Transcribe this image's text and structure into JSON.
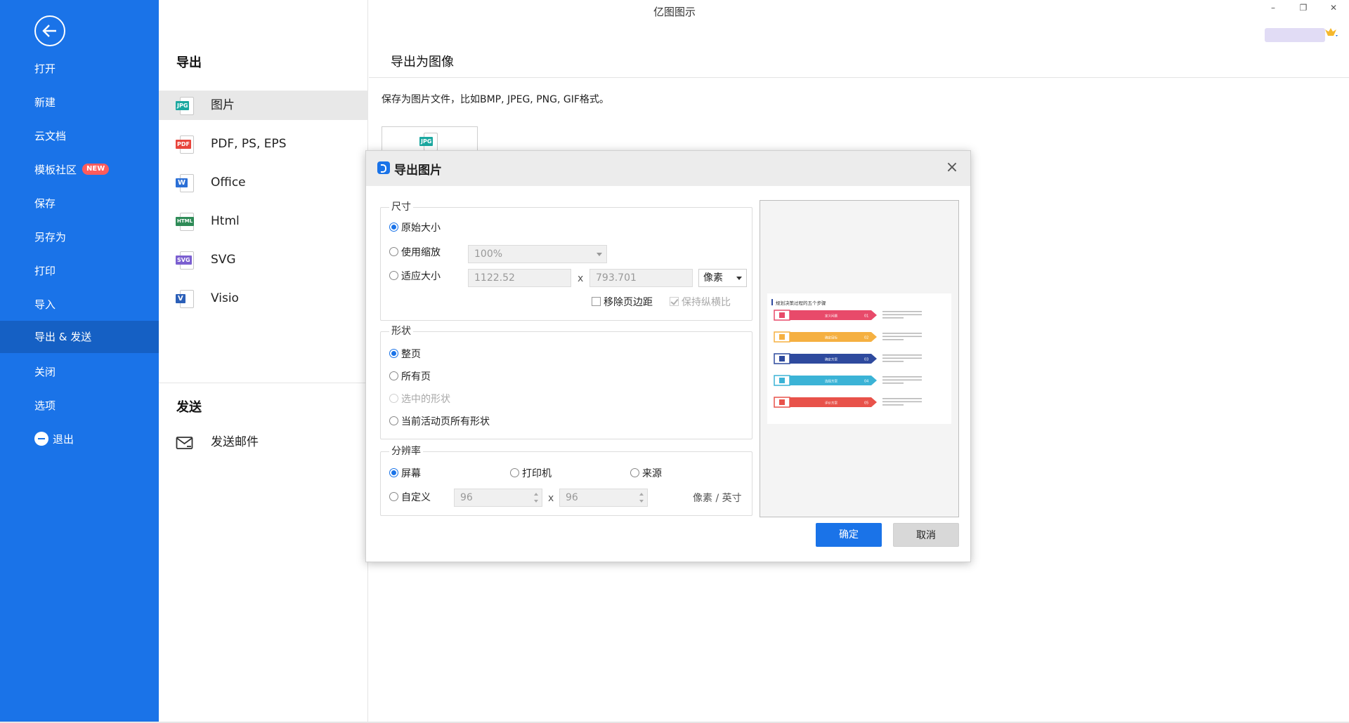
{
  "app": {
    "title": "亿图图示"
  },
  "sidebar": {
    "items": [
      {
        "label": "打开"
      },
      {
        "label": "新建"
      },
      {
        "label": "云文档"
      },
      {
        "label": "模板社区",
        "badge": "NEW"
      },
      {
        "label": "保存"
      },
      {
        "label": "另存为"
      },
      {
        "label": "打印"
      },
      {
        "label": "导入"
      },
      {
        "label": "导出 & 发送",
        "active": true
      },
      {
        "label": "关闭"
      },
      {
        "label": "选项"
      },
      {
        "label": "退出"
      }
    ]
  },
  "middle": {
    "export_title": "导出",
    "export_items": [
      {
        "label": "图片",
        "tag": "JPG",
        "color": "#1ba8a0"
      },
      {
        "label": "PDF, PS, EPS",
        "tag": "PDF",
        "color": "#e8453c"
      },
      {
        "label": "Office",
        "tag": "W",
        "color": "#2b6fd6"
      },
      {
        "label": "Html",
        "tag": "HTML",
        "color": "#2e8b57"
      },
      {
        "label": "SVG",
        "tag": "SVG",
        "color": "#7b5fd0"
      },
      {
        "label": "Visio",
        "tag": "V",
        "color": "#2b5fb8"
      }
    ],
    "send_title": "发送",
    "send_items": [
      {
        "label": "发送邮件"
      }
    ]
  },
  "right": {
    "title": "导出为图像",
    "description": "保存为图片文件，比如BMP, JPEG, PNG, GIF格式。",
    "card_tag": "JPG"
  },
  "dialog": {
    "title": "导出图片",
    "size": {
      "title": "尺寸",
      "opt_original": "原始大小",
      "opt_zoom": "使用缩放",
      "zoom_value": "100%",
      "opt_fit": "适应大小",
      "width": "1122.52",
      "x": "x",
      "height": "793.701",
      "unit": "像素",
      "remove_margin": "移除页边距",
      "keep_ratio": "保持纵横比"
    },
    "shape": {
      "title": "形状",
      "opt_whole_page": "整页",
      "opt_all_pages": "所有页",
      "opt_selected": "选中的形状",
      "opt_current_page": "当前活动页所有形状"
    },
    "resolution": {
      "title": "分辨率",
      "opt_screen": "屏幕",
      "opt_printer": "打印机",
      "opt_source": "来源",
      "opt_custom": "自定义",
      "dpi_x": "96",
      "x": "x",
      "dpi_y": "96",
      "unit": "像素 / 英寸"
    },
    "preview": {
      "heading": "规划决策过程的五个步骤",
      "steps": [
        {
          "label": "定义问题",
          "num": "01",
          "color": "#e84a6a"
        },
        {
          "label": "确定目标",
          "num": "02",
          "color": "#f5b041"
        },
        {
          "label": "确定方案",
          "num": "03",
          "color": "#2e4a9e"
        },
        {
          "label": "选择方案",
          "num": "04",
          "color": "#3bb3d6"
        },
        {
          "label": "评价方案",
          "num": "05",
          "color": "#e8524a"
        }
      ]
    },
    "ok_label": "确定",
    "cancel_label": "取消"
  }
}
